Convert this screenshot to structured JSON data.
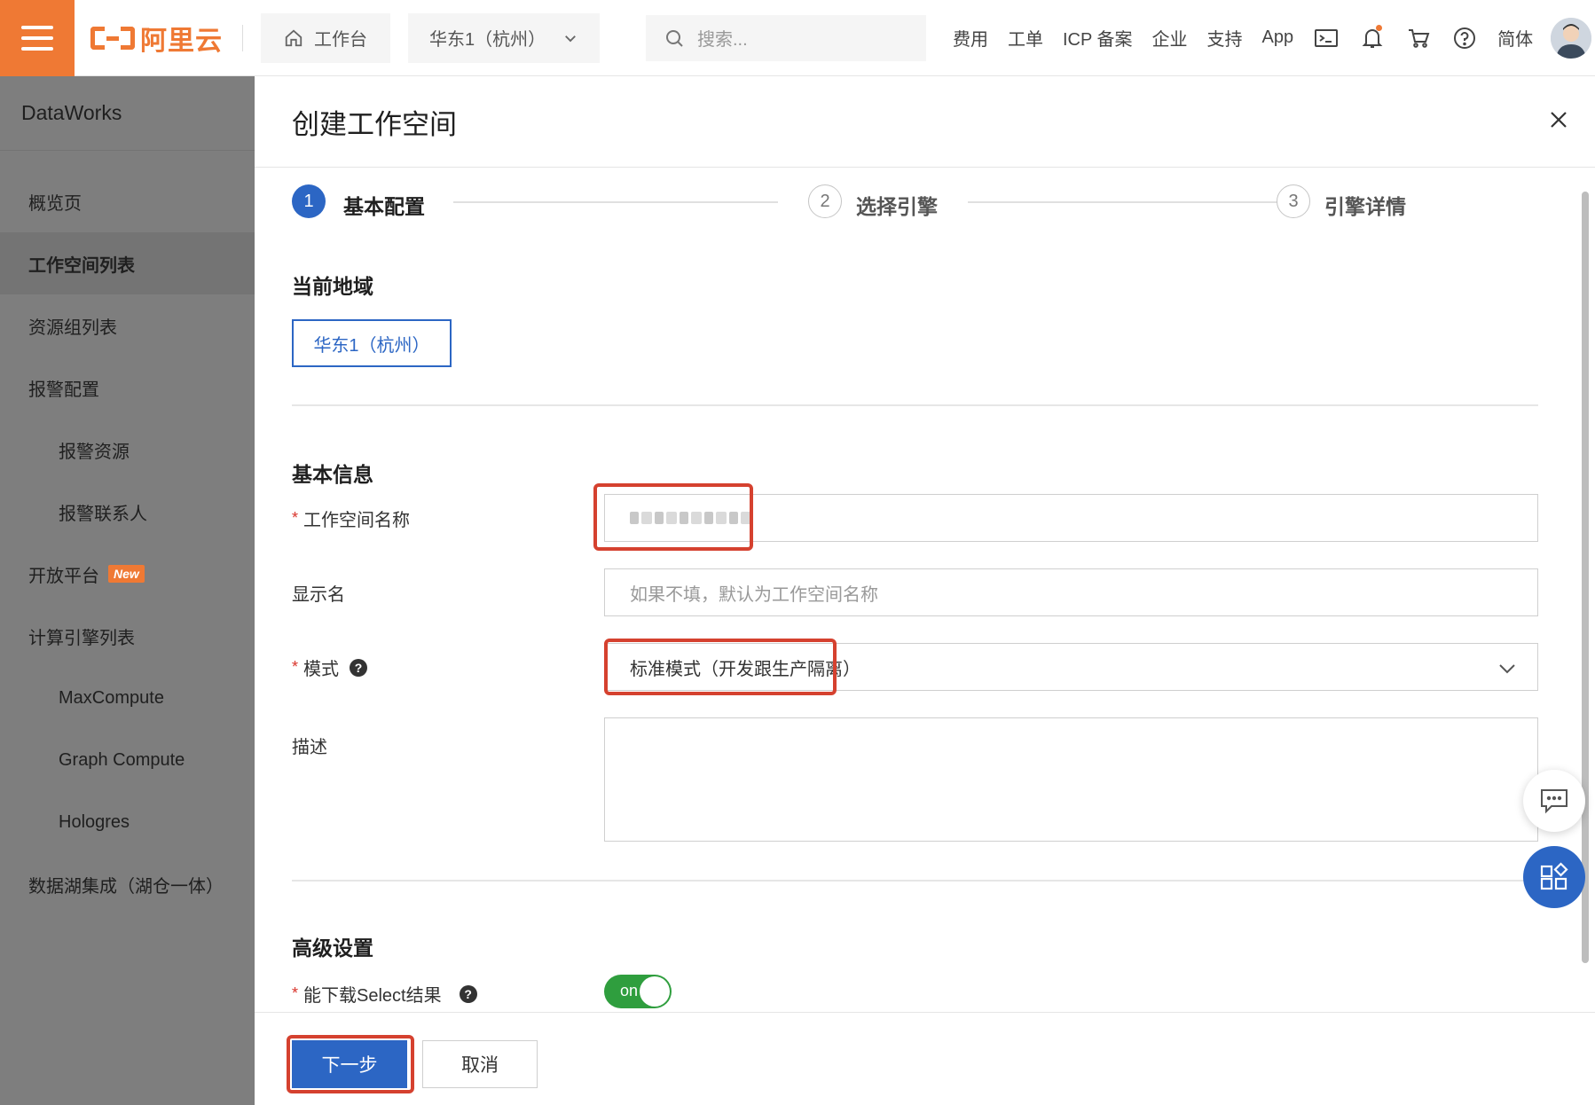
{
  "topbar": {
    "brand_text": "阿里云",
    "workbench_label": "工作台",
    "region_label": "华东1（杭州）",
    "search_placeholder": "搜索...",
    "links": [
      "费用",
      "工单",
      "ICP 备案",
      "企业",
      "支持",
      "App"
    ],
    "language_label": "简体"
  },
  "sidebar": {
    "title": "DataWorks",
    "items": [
      {
        "label": "概览页"
      },
      {
        "label": "工作空间列表"
      },
      {
        "label": "资源组列表"
      },
      {
        "label": "报警配置"
      },
      {
        "label": "报警资源"
      },
      {
        "label": "报警联系人"
      },
      {
        "label": "开放平台",
        "badge": "New"
      },
      {
        "label": "计算引擎列表"
      },
      {
        "label": "MaxCompute"
      },
      {
        "label": "Graph Compute"
      },
      {
        "label": "Hologres"
      },
      {
        "label": "数据湖集成（湖仓一体）"
      }
    ]
  },
  "panel": {
    "title": "创建工作空间",
    "steps": [
      {
        "number": "1",
        "label": "基本配置"
      },
      {
        "number": "2",
        "label": "选择引擎"
      },
      {
        "number": "3",
        "label": "引擎详情"
      }
    ],
    "current_region_title": "当前地域",
    "current_region_value": "华东1（杭州）",
    "basic_info_title": "基本信息",
    "fields": {
      "workspace_name_label": "工作空间名称",
      "display_name_label": "显示名",
      "display_name_placeholder": "如果不填，默认为工作空间名称",
      "mode_label": "模式",
      "mode_value": "标准模式（开发跟生产隔离）",
      "description_label": "描述"
    },
    "advanced_title": "高级设置",
    "download_select_label": "能下载Select结果",
    "toggle_text": "on",
    "required_mark": "*",
    "help_mark": "?",
    "next_button": "下一步",
    "cancel_button": "取消"
  },
  "colors": {
    "brand_orange": "#ef7934",
    "primary_blue": "#2c66c4",
    "highlight_red": "#d5412f",
    "toggle_green": "#2f9e3e"
  },
  "icons": [
    "menu-icon",
    "home-icon",
    "chevron-down-icon",
    "search-icon",
    "terminal-icon",
    "bell-icon",
    "cart-icon",
    "help-circle-icon",
    "close-icon",
    "chat-icon",
    "apps-icon"
  ]
}
